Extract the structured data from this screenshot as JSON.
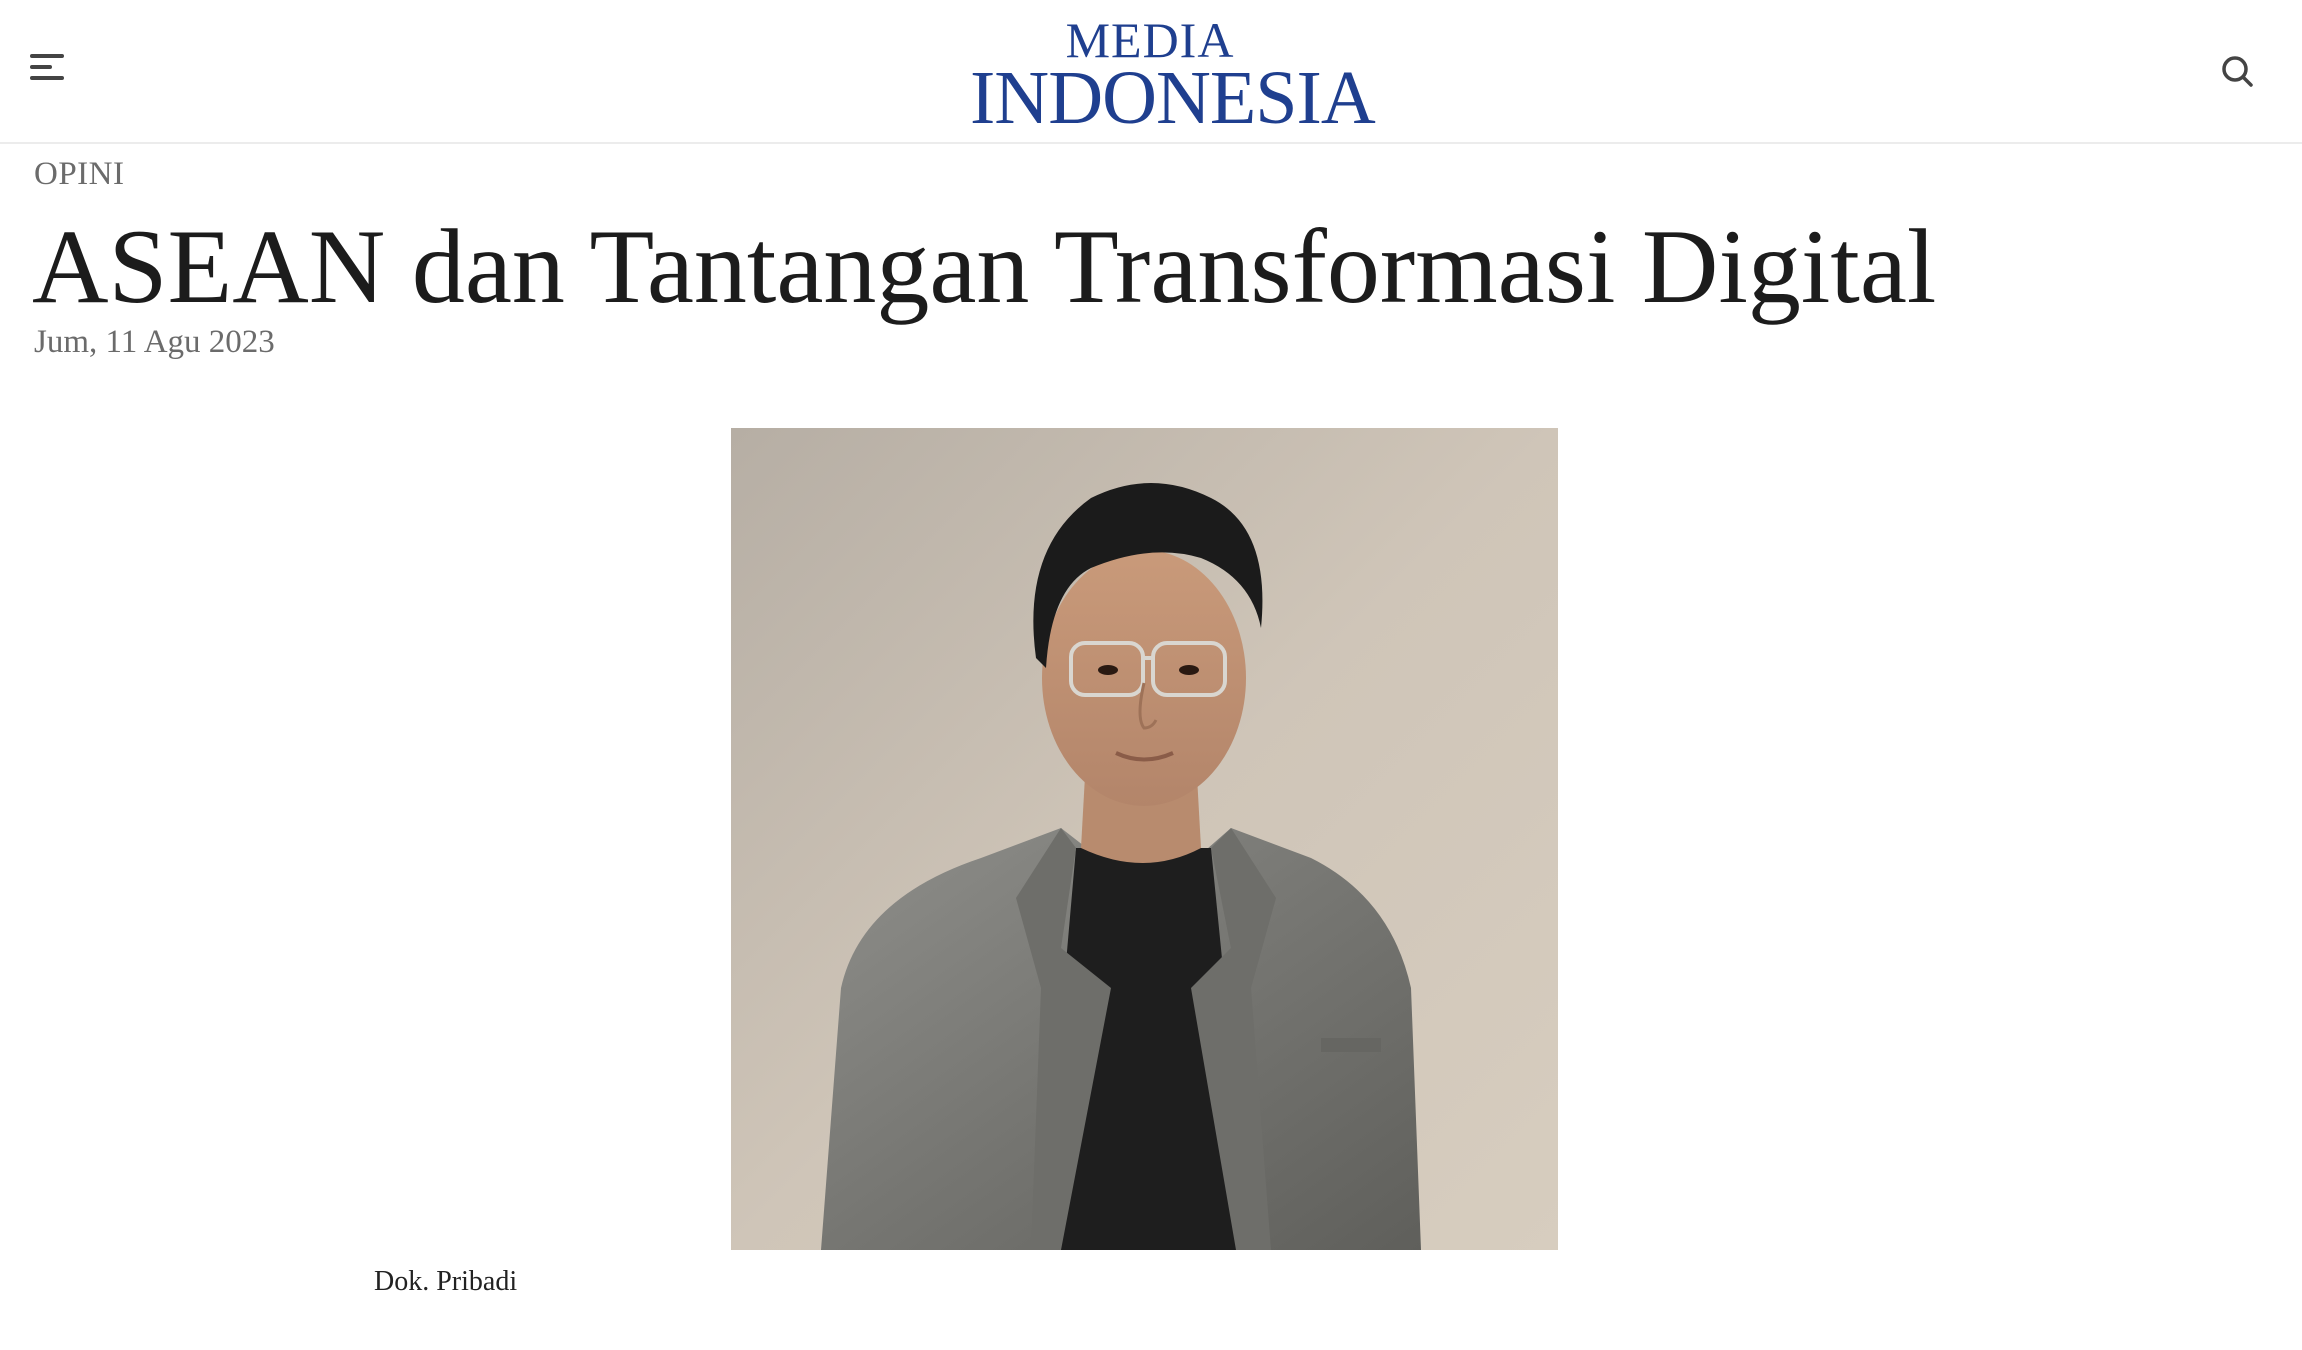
{
  "header": {
    "logo_top": "MEDIA",
    "logo_bottom": "INDONESIA",
    "menu_icon": "hamburger-menu-icon",
    "search_icon": "search-icon"
  },
  "article": {
    "category": "OPINI",
    "title": "ASEAN dan Tantangan Transformasi Digital",
    "date": "Jum, 11 Agu 2023",
    "photo_caption": "Dok. Pribadi"
  },
  "colors": {
    "brand": "#1f3f8f",
    "title_text": "#1c1c1c",
    "meta_text": "#6b6b6b",
    "photo_background": "#c9beb0"
  }
}
